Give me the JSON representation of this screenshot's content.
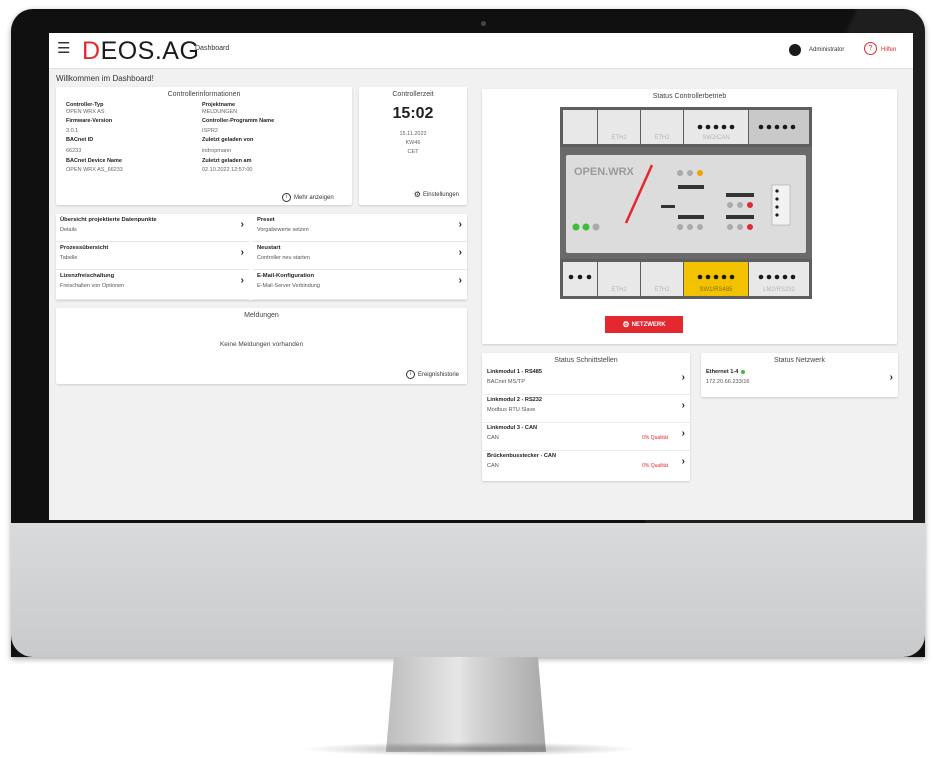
{
  "header": {
    "logo_text": "DEOS.AG",
    "breadcrumb": "Dashboard",
    "user_name": "Administrator",
    "help_label": "Hilfen"
  },
  "welcome": "Willkommen im Dashboard!",
  "controller_info": {
    "title": "Controllerinformationen",
    "fields": [
      {
        "label": "Controller-Typ",
        "value": "OPEN WRX AS"
      },
      {
        "label": "Firmware-Version",
        "value": "3.0.1"
      },
      {
        "label": "BACnet ID",
        "value": "66233"
      },
      {
        "label": "BACnet Device Name",
        "value": "OPEN WRX AS_66233"
      },
      {
        "label": "Projektname",
        "value": "MELDUNGEN"
      },
      {
        "label": "Controller-Programm Name",
        "value": "ISPR2"
      },
      {
        "label": "Zuletzt geladen von",
        "value": "indropmann"
      },
      {
        "label": "Zuletzt geladen am",
        "value": "02.10.2022 12:57:00"
      }
    ],
    "more_label": "Mehr anzeigen"
  },
  "controller_time": {
    "title": "Controllerzeit",
    "time": "15:02",
    "date": "15.11.2022",
    "week": "KW46",
    "tz": "CET",
    "settings_label": "Einstellungen"
  },
  "nav": [
    {
      "title": "Übersicht projektierte Datenpunkte",
      "sub": "Details"
    },
    {
      "title": "Preset",
      "sub": "Vorgabewerte setzen"
    },
    {
      "title": "Prozessübersicht",
      "sub": "Tabelle"
    },
    {
      "title": "Neustart",
      "sub": "Controller neu starten"
    },
    {
      "title": "Lizenzfreischaltung",
      "sub": "Freischalten von Optionen"
    },
    {
      "title": "E-Mail-Konfiguration",
      "sub": "E-Mail-Server Verbindung"
    }
  ],
  "messages": {
    "title": "Meldungen",
    "empty": "Keine Meldungen vorhanden",
    "link": "Ereignishistorie"
  },
  "status_controller": {
    "title": "Status Controllerbetrieb",
    "device_name": "OPEN.WRX",
    "port_labels": [
      "ETH1",
      "ETH2",
      "SW2/CAN",
      "ETH1",
      "ETH2",
      "SW1/RS485",
      "LM2/RS232"
    ],
    "network_button": "NETZWERK"
  },
  "status_interfaces": {
    "title": "Status Schnittstellen",
    "rows": [
      {
        "title": "Linkmodul 1 - RS485",
        "sub": "BACnet MS/TP",
        "quality": ""
      },
      {
        "title": "Linkmodul 2 - RS232",
        "sub": "Modbus RTU Slave",
        "quality": ""
      },
      {
        "title": "Linkmodul 3 - CAN",
        "sub": "CAN",
        "quality": "0% Qualität"
      },
      {
        "title": "Brückenbusstecker - CAN",
        "sub": "CAN",
        "quality": "0% Qualität"
      }
    ]
  },
  "status_network": {
    "title": "Status Netzwerk",
    "row_title": "Ethernet 1-4",
    "row_value": "172.20.66.233/16"
  },
  "colors": {
    "accent": "#e3282f",
    "status_ok": "#3bbf3b",
    "port_highlight": "#f2c200"
  }
}
